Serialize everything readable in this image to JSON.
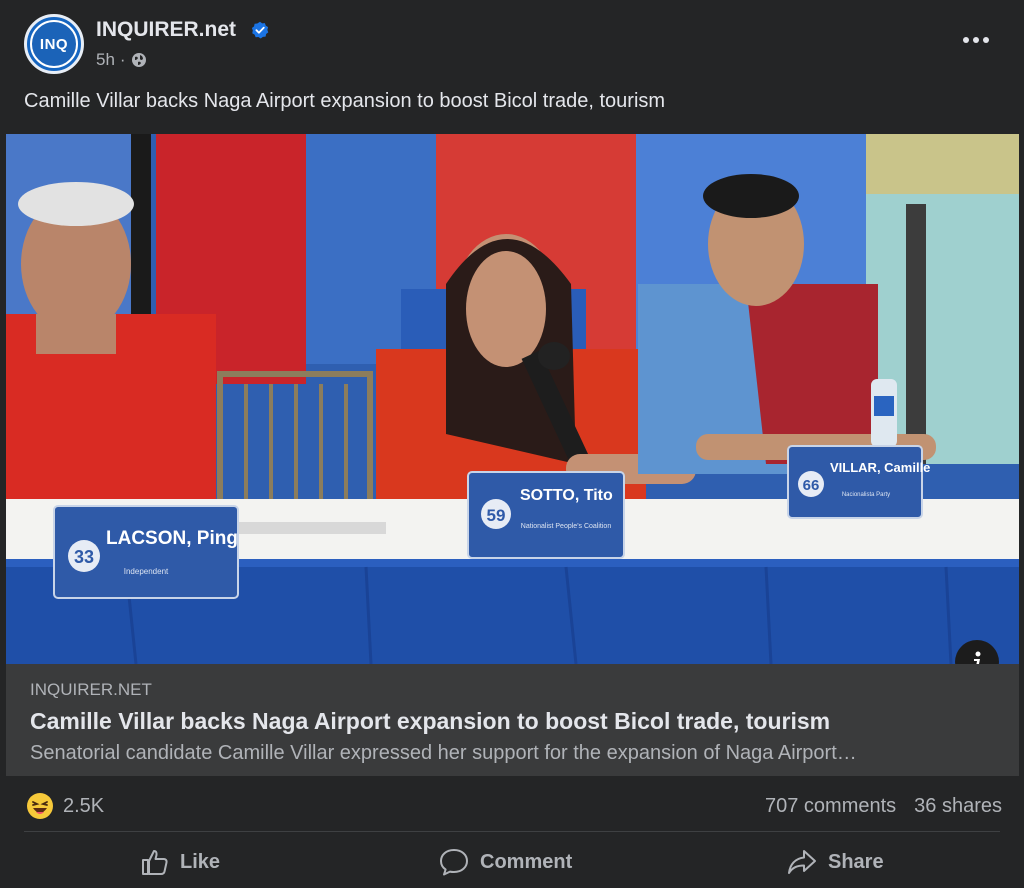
{
  "post": {
    "page_name": "INQUIRER.net",
    "avatar_text": "INQ",
    "time": "5h",
    "separator": "·",
    "caption": "Camille Villar backs Naga Airport expansion to boost Bicol trade, tourism"
  },
  "image": {
    "placards": [
      {
        "number": "33",
        "name": "LACSON, Ping",
        "party": "Independent"
      },
      {
        "number": "59",
        "name": "SOTTO, Tito",
        "party": "Nationalist People's Coalition"
      },
      {
        "number": "66",
        "name": "VILLAR, Camille",
        "party": "Nacionalista Party"
      }
    ]
  },
  "link_card": {
    "domain": "INQUIRER.NET",
    "title": "Camille Villar backs Naga Airport expansion to boost Bicol trade, tourism",
    "description": "Senatorial candidate Camille Villar expressed her support for the expansion of Naga Airport…"
  },
  "stats": {
    "reactions": "2.5K",
    "comments": "707 comments",
    "shares": "36 shares"
  },
  "actions": {
    "like": "Like",
    "comment": "Comment",
    "share": "Share"
  },
  "colors": {
    "background": "#242526",
    "card": "#3a3b3c",
    "text_primary": "#e4e6eb",
    "text_secondary": "#b0b3b8",
    "verified": "#1b74e4"
  },
  "icons": [
    "globe-icon",
    "verified-icon",
    "more-icon",
    "info-icon",
    "haha-reaction-icon",
    "like-icon",
    "comment-icon",
    "share-icon"
  ]
}
